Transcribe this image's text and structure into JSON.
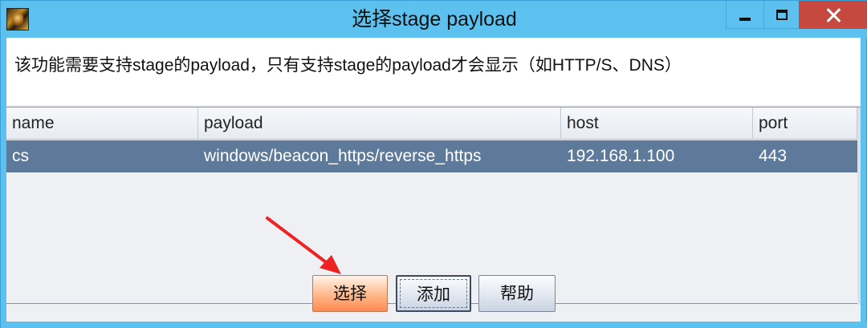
{
  "window": {
    "title": "选择stage payload",
    "close_color": "#c7483f",
    "titlebar_color": "#5cc1ef"
  },
  "description": "该功能需要支持stage的payload，只有支持stage的payload才会显示（如HTTP/S、DNS）",
  "table": {
    "columns": [
      "name",
      "payload",
      "host",
      "port"
    ],
    "rows": [
      [
        "cs",
        "windows/beacon_https/reverse_https",
        "192.168.1.100",
        "443"
      ]
    ],
    "selected_row_color": "#5e7a9a"
  },
  "buttons": {
    "select": "选择",
    "add": "添加",
    "help": "帮助"
  },
  "annotation": {
    "arrow_color": "#ee2222",
    "points_to": "select"
  }
}
